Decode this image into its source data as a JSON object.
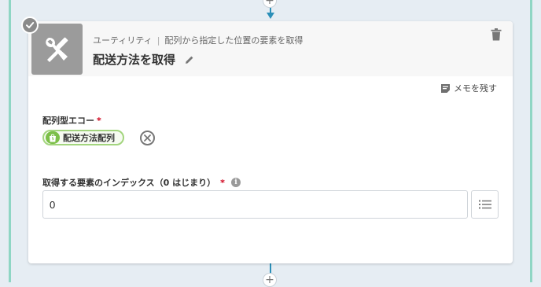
{
  "step": {
    "category": "ユーティリティ",
    "separator": "|",
    "action": "配列から指定した位置の要素を取得",
    "title": "配送方法を取得"
  },
  "memo_label": "メモを残す",
  "fields": {
    "array": {
      "label": "配列型エコー",
      "required_mark": "*",
      "chip_label": "配送方法配列"
    },
    "index": {
      "label": "取得する要素のインデックス（0 はじまり）",
      "required_mark": "*",
      "info_glyph": "i",
      "value": "0"
    }
  },
  "flow": {
    "add_symbol": "+"
  },
  "icons": {
    "status": "check-icon",
    "step": "tools-icon",
    "rename": "pencil-icon",
    "delete": "trash-icon",
    "memo": "memo-icon",
    "chip": "shopify-bag-icon",
    "remove": "close-circle-icon",
    "info": "info-icon",
    "list": "list-icon"
  },
  "colors": {
    "connector": "#2b8fb8",
    "lane_border": "#8fd6c4",
    "required": "#d0021b",
    "chip_border": "#a3d57e",
    "chip_icon": "#7cbf48"
  }
}
